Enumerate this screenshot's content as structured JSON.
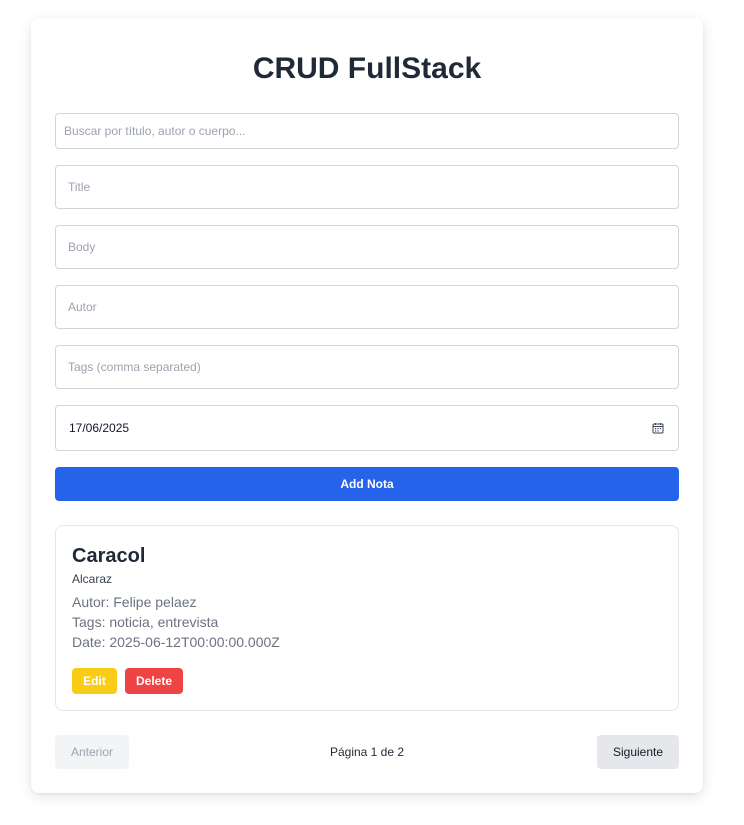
{
  "app": {
    "title": "CRUD FullStack"
  },
  "form": {
    "search_placeholder": "Buscar por título, autor o cuerpo...",
    "title_placeholder": "Title",
    "body_placeholder": "Body",
    "autor_placeholder": "Autor",
    "tags_placeholder": "Tags (comma separated)",
    "date_value": "17/06/2025",
    "submit_label": "Add Nota",
    "calendar_icon": "calendar-icon"
  },
  "notes": [
    {
      "title": "Caracol",
      "body": "Alcaraz",
      "autor_line": "Autor: Felipe pelaez",
      "tags_line": "Tags: noticia, entrevista",
      "date_line": "Date: 2025-06-12T00:00:00.000Z",
      "edit_label": "Edit",
      "delete_label": "Delete"
    }
  ],
  "pagination": {
    "prev_label": "Anterior",
    "page_info": "Página 1 de 2",
    "next_label": "Siguiente"
  },
  "colors": {
    "primary": "#2563eb",
    "edit": "#facc15",
    "delete": "#ef4444"
  }
}
